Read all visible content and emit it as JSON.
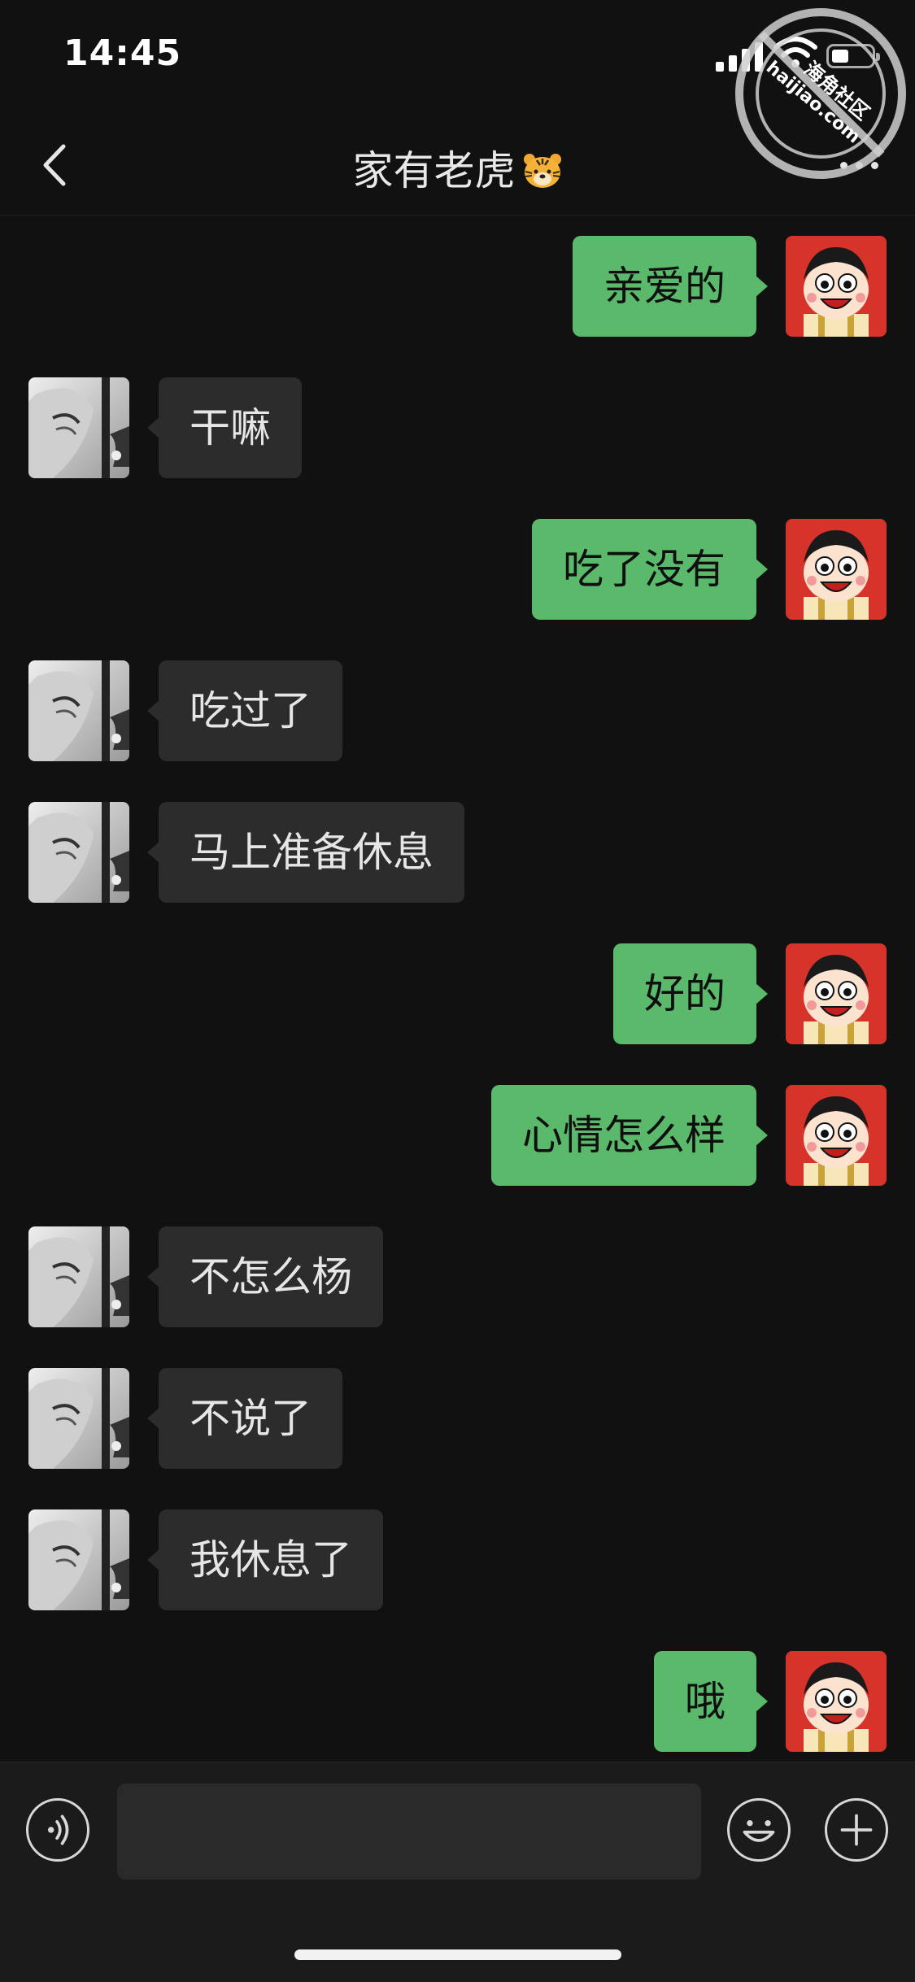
{
  "status_bar": {
    "time": "14:45"
  },
  "header": {
    "title": "家有老虎",
    "title_emoji": "tiger-face-emoji"
  },
  "watermark": {
    "line1": "海角社区",
    "line2": "haijiao.com"
  },
  "messages": [
    {
      "side": "right",
      "text": "亲爱的"
    },
    {
      "side": "left",
      "text": "干嘛"
    },
    {
      "side": "right",
      "text": "吃了没有"
    },
    {
      "side": "left",
      "text": "吃过了"
    },
    {
      "side": "left",
      "text": "马上准备休息"
    },
    {
      "side": "right",
      "text": "好的"
    },
    {
      "side": "right",
      "text": "心情怎么样"
    },
    {
      "side": "left",
      "text": "不怎么杨"
    },
    {
      "side": "left",
      "text": "不说了"
    },
    {
      "side": "left",
      "text": "我休息了"
    },
    {
      "side": "right",
      "text": "哦"
    }
  ],
  "input": {
    "value": "",
    "placeholder": ""
  },
  "icons": {
    "back": "chevron-left-icon",
    "more": "more-dots-icon",
    "voice": "voice-icon",
    "emoji": "emoji-icon",
    "add": "plus-icon"
  },
  "colors": {
    "background": "#111111",
    "sent_bubble": "#5ab96b",
    "received_bubble": "#2c2c2c",
    "input_bar": "#1b1b1b"
  }
}
